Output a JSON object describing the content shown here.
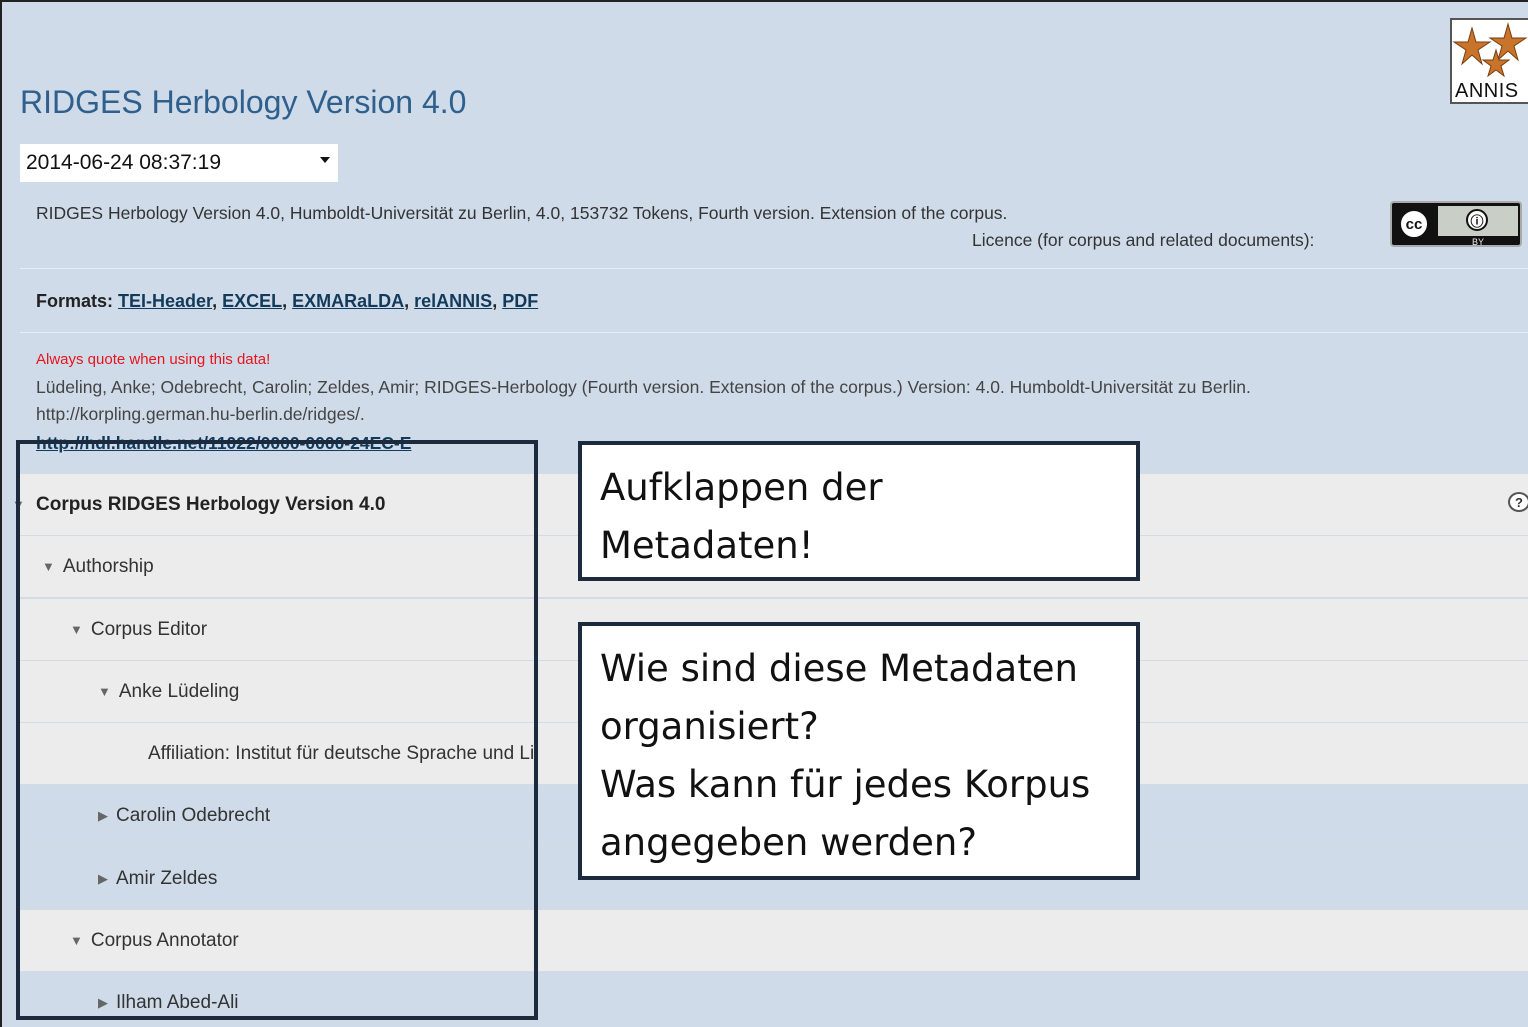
{
  "page": {
    "title": "RIDGES Herbology Version 4.0",
    "logo_text": "ANNIS"
  },
  "version_select": {
    "value": "2014-06-24 08:37:19"
  },
  "corpus_info": {
    "description": "RIDGES Herbology Version 4.0, Humboldt-Universität zu Berlin, 4.0, 153732 Tokens, Fourth version. Extension of the corpus.",
    "licence_label": "Licence (for corpus and related documents):",
    "licence_badge": {
      "cc": "cc",
      "by_symbol": "ⓘ",
      "by_text": "BY"
    }
  },
  "formats": {
    "label": "Formats:",
    "links": [
      "TEI-Header",
      "EXCEL",
      "EXMARaLDA",
      "relANNIS",
      "PDF"
    ]
  },
  "citation": {
    "warning": "Always quote when using this data!",
    "line1": "Lüdeling, Anke; Odebrecht, Carolin; Zeldes, Amir; RIDGES-Herbology (Fourth version. Extension of the corpus.) Version: 4.0. Humboldt-Universität zu Berlin.",
    "line2": "http://korpling.german.hu-berlin.de/ridges/.",
    "handle": "http://hdl.handle.net/11022/0000-0000-24EC-E"
  },
  "tree": {
    "header": "Corpus RIDGES Herbology Version 4.0",
    "help_symbol": "?",
    "rows": [
      {
        "label": "Authorship",
        "expanded": true,
        "level": 1
      },
      {
        "label": "Corpus Editor",
        "expanded": true,
        "level": 2
      },
      {
        "label": "Anke Lüdeling",
        "expanded": true,
        "level": 3
      },
      {
        "label": "Affiliation: Institut für deutsche Sprache und Li",
        "expanded": null,
        "level": 4
      },
      {
        "label": "Carolin Odebrecht",
        "expanded": false,
        "level": 3
      },
      {
        "label": "Amir Zeldes",
        "expanded": false,
        "level": 3
      },
      {
        "label": "Corpus Annotator",
        "expanded": true,
        "level": 2
      },
      {
        "label": "Ilham Abed-Ali",
        "expanded": false,
        "level": 3
      }
    ]
  },
  "callouts": {
    "first": [
      "Aufklappen der",
      "Metadaten!"
    ],
    "second": [
      "Wie sind diese Metadaten",
      "organisiert?",
      "Was kann für jedes Korpus",
      "angegeben werden?"
    ]
  },
  "colors": {
    "background": "#cfdbe9",
    "title": "#2f5f8c",
    "warning": "#e8141c",
    "link": "#123a5a",
    "highlight_border": "#1b2a3d"
  }
}
